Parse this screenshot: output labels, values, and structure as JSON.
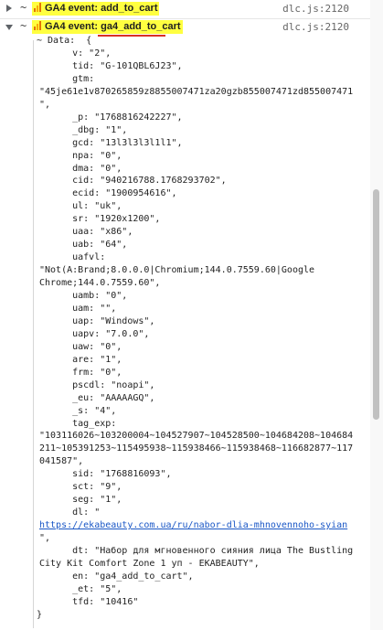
{
  "events": [
    {
      "badge": "GA4 event: add_to_cart",
      "source": "dlc.js:2120",
      "expanded": false
    },
    {
      "badge": "GA4 event: ga4_add_to_cart",
      "source": "dlc.js:2120",
      "expanded": true
    }
  ],
  "tilde": "~",
  "data_lines": [
    {
      "t": "~ Data:  {"
    },
    {
      "t": "      v: \"2\","
    },
    {
      "t": "      tid: \"G-101QBL6J23\","
    },
    {
      "t": "      gtm:"
    },
    {
      "t": "\"45je61e1v870265859z8855007471za20gzb855007471zd855007471"
    },
    {
      "t": "\","
    },
    {
      "t": "      _p: \"1768816242227\","
    },
    {
      "t": "      _dbg: \"1\","
    },
    {
      "t": "      gcd: \"13l3l3l3l1l1\","
    },
    {
      "t": "      npa: \"0\","
    },
    {
      "t": "      dma: \"0\","
    },
    {
      "t": "      cid: \"940216788.1768293702\","
    },
    {
      "t": "      ecid: \"1900954616\","
    },
    {
      "t": "      ul: \"uk\","
    },
    {
      "t": "      sr: \"1920x1200\","
    },
    {
      "t": "      uaa: \"x86\","
    },
    {
      "t": "      uab: \"64\","
    },
    {
      "t": "      uafvl:"
    },
    {
      "t": "\"Not(A:Brand;8.0.0.0|Chromium;144.0.7559.60|Google"
    },
    {
      "t": "Chrome;144.0.7559.60\","
    },
    {
      "t": "      uamb: \"0\","
    },
    {
      "t": "      uam: \"\","
    },
    {
      "t": "      uap: \"Windows\","
    },
    {
      "t": "      uapv: \"7.0.0\","
    },
    {
      "t": "      uaw: \"0\","
    },
    {
      "t": "      are: \"1\","
    },
    {
      "t": "      frm: \"0\","
    },
    {
      "t": "      pscdl: \"noapi\","
    },
    {
      "t": "      _eu: \"AAAAAGQ\","
    },
    {
      "t": "      _s: \"4\","
    },
    {
      "t": "      tag_exp:"
    },
    {
      "t": "\"103116026~103200004~104527907~104528500~104684208~104684"
    },
    {
      "t": "211~105391253~115495938~115938466~115938468~116682877~117"
    },
    {
      "t": "041587\","
    },
    {
      "t": "      sid: \"1768816093\","
    },
    {
      "t": "      sct: \"9\","
    },
    {
      "t": "      seg: \"1\","
    },
    {
      "t": "      dl: \""
    },
    {
      "t": "https://ekabeauty.com.ua/ru/nabor-dlia-mhnovennoho-syian",
      "link": true
    },
    {
      "t": "\","
    },
    {
      "t": "      dt: \"Набор для мгновенного сияния лица The Bustling"
    },
    {
      "t": "City Kit Comfort Zone 1 уп - EKABEAUTY\","
    },
    {
      "t": "      en: \"ga4_add_to_cart\","
    },
    {
      "t": "      _et: \"5\","
    },
    {
      "t": "      tfd: \"10416\""
    },
    {
      "t": "}"
    }
  ]
}
